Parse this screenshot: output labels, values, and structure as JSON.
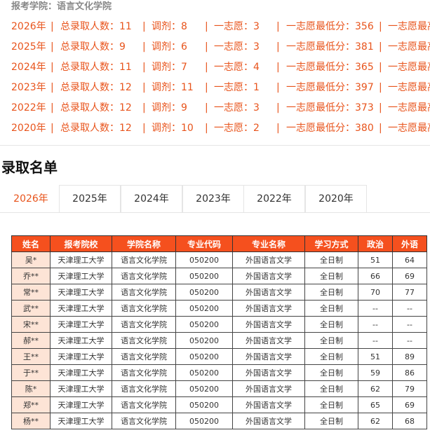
{
  "college_label": "报考学院：语言文化学院",
  "stats": [
    {
      "year": "2026年",
      "total": "总录取人数：11",
      "adjust": "调剂：8",
      "first": "一志愿：3",
      "min": "一志愿最低分：356",
      "extra": "一志愿最高"
    },
    {
      "year": "2025年",
      "total": "总录取人数：9",
      "adjust": "调剂：6",
      "first": "一志愿：3",
      "min": "一志愿最低分：381",
      "extra": "一志愿最高"
    },
    {
      "year": "2024年",
      "total": "总录取人数：11",
      "adjust": "调剂：7",
      "first": "一志愿：4",
      "min": "一志愿最低分：365",
      "extra": "一志愿最高"
    },
    {
      "year": "2023年",
      "total": "总录取人数：12",
      "adjust": "调剂：11",
      "first": "一志愿：1",
      "min": "一志愿最低分：397",
      "extra": "一志愿最高"
    },
    {
      "year": "2022年",
      "total": "总录取人数：12",
      "adjust": "调剂：9",
      "first": "一志愿：3",
      "min": "一志愿最低分：373",
      "extra": "一志愿最高"
    },
    {
      "year": "2020年",
      "total": "总录取人数：12",
      "adjust": "调剂：10",
      "first": "一志愿：2",
      "min": "一志愿最低分：380",
      "extra": "一志愿最高"
    }
  ],
  "separator": "|",
  "list_title": "录取名单",
  "tabs": [
    "2026年",
    "2025年",
    "2024年",
    "2023年",
    "2022年",
    "2020年"
  ],
  "active_tab": 0,
  "table": {
    "headers": [
      "姓名",
      "报考院校",
      "学院名称",
      "专业代码",
      "专业名称",
      "学习方式",
      "政治",
      "外语"
    ],
    "rows": [
      [
        "吴*",
        "天津理工大学",
        "语言文化学院",
        "050200",
        "外国语言文学",
        "全日制",
        "51",
        "64"
      ],
      [
        "乔**",
        "天津理工大学",
        "语言文化学院",
        "050200",
        "外国语言文学",
        "全日制",
        "66",
        "69"
      ],
      [
        "常**",
        "天津理工大学",
        "语言文化学院",
        "050200",
        "外国语言文学",
        "全日制",
        "70",
        "77"
      ],
      [
        "武**",
        "天津理工大学",
        "语言文化学院",
        "050200",
        "外国语言文学",
        "全日制",
        "--",
        "--"
      ],
      [
        "宋**",
        "天津理工大学",
        "语言文化学院",
        "050200",
        "外国语言文学",
        "全日制",
        "--",
        "--"
      ],
      [
        "郝**",
        "天津理工大学",
        "语言文化学院",
        "050200",
        "外国语言文学",
        "全日制",
        "--",
        "--"
      ],
      [
        "王**",
        "天津理工大学",
        "语言文化学院",
        "050200",
        "外国语言文学",
        "全日制",
        "51",
        "89"
      ],
      [
        "于**",
        "天津理工大学",
        "语言文化学院",
        "050200",
        "外国语言文学",
        "全日制",
        "59",
        "86"
      ],
      [
        "陈*",
        "天津理工大学",
        "语言文化学院",
        "050200",
        "外国语言文学",
        "全日制",
        "62",
        "79"
      ],
      [
        "郑**",
        "天津理工大学",
        "语言文化学院",
        "050200",
        "外国语言文学",
        "全日制",
        "65",
        "69"
      ],
      [
        "杨**",
        "天津理工大学",
        "语言文化学院",
        "050200",
        "外国语言文学",
        "全日制",
        "62",
        "68"
      ]
    ]
  },
  "colors": {
    "accent": "#e8541c",
    "header_bg": "#f5501e",
    "name_cell_bg": "#fde4d6"
  }
}
